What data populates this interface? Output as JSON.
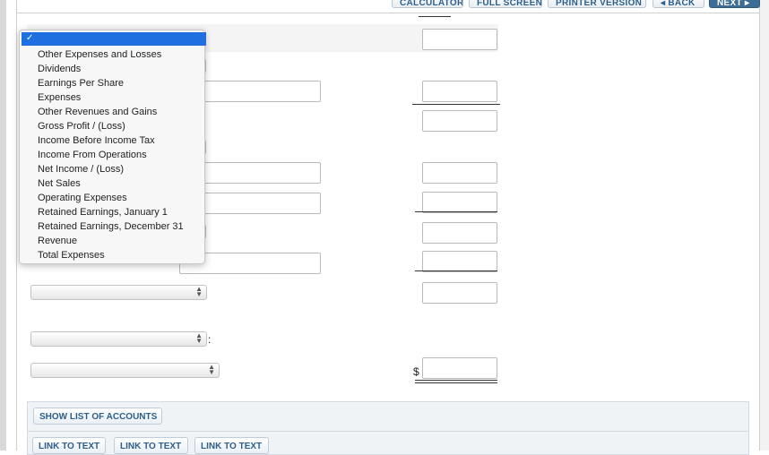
{
  "toolbar": {
    "calculator": "CALCULATOR",
    "full_screen": "FULL SCREEN",
    "printer_version": "PRINTER VERSION",
    "back": "◂ BACK",
    "next": "NEXT ▸"
  },
  "dropdown": {
    "selected_mark": "✓",
    "options": [
      "Other Expenses and Losses",
      "Dividends",
      "Earnings Per Share",
      "Expenses",
      "Other Revenues and Gains",
      "Gross Profit / (Loss)",
      "Income Before Income Tax",
      "Income From Operations",
      "Net Income / (Loss)",
      "Net Sales",
      "Operating Expenses",
      "Retained Earnings, January 1",
      "Retained Earnings, December 31",
      "Revenue",
      "Total Expenses"
    ]
  },
  "form": {
    "colon": ":",
    "dollar": "$"
  },
  "bottom": {
    "show_list": "SHOW LIST OF ACCOUNTS",
    "link1": "LINK TO TEXT",
    "link2": "LINK TO TEXT",
    "link3": "LINK TO TEXT"
  },
  "colors": {
    "accent": "#3d6c96",
    "selection": "#1f6fe0"
  }
}
